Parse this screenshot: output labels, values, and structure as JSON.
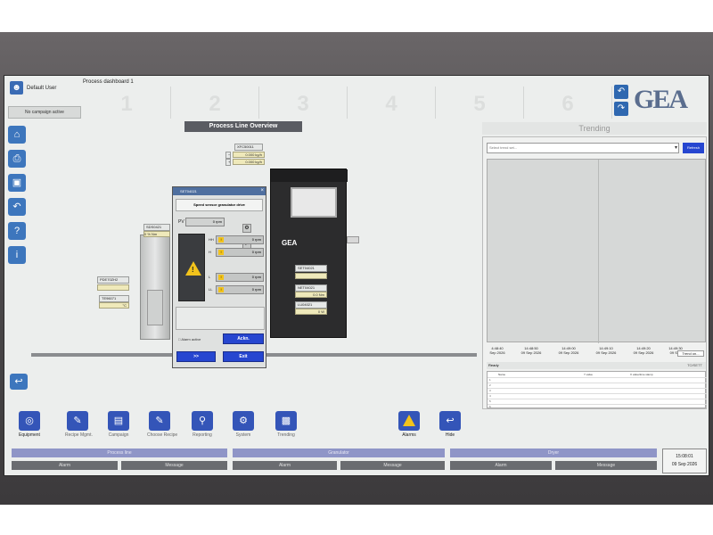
{
  "header": {
    "user": "Default User",
    "campaign": "No campaign active",
    "dashboard_title": "Process dashboard 1",
    "steps": [
      "1",
      "2",
      "3",
      "4",
      "5",
      "6"
    ],
    "logo": "GEA"
  },
  "overview": {
    "title": "Process Line Overview",
    "flow_tag": "XFC50011",
    "flow_value_1": "0.000 kg/h",
    "flow_value_2": "0.000 kg/h",
    "dryer_logo": "GEA",
    "dryer_tag_1": "SET04021",
    "dryer_tag_2": "NET04021",
    "dryer_value_2": "0.0 Nm",
    "dryer_tag_3": "LU04021",
    "dryer_value_3": "0 W",
    "left_tag_1": "PDE70ZH2",
    "left_tag_2": "TE96071",
    "left_value_2": "°C",
    "gran_tag": "SDS0421",
    "gran_value": "0 % Nm"
  },
  "popup": {
    "bar_title": "SET04021",
    "close": "×",
    "heading": "Speed sensor granulator drive",
    "pv_label": "PV",
    "pv_value": "0 rpm",
    "hh_label": "HH",
    "hh_value": "0 rpm",
    "h_label": "H",
    "h_value": "0 rpm",
    "l_label": "L",
    "l_value": "0 rpm",
    "ll_label": "LL",
    "ll_value": "0 rpm",
    "alarm_active": "Alarm active",
    "ackn": "Ackn.",
    "more": ">>",
    "exit": "Exit"
  },
  "trending": {
    "title": "Trending",
    "select_placeholder": "Select trend set...",
    "refresh": "Refresh",
    "times": [
      {
        "time": "4:48:40",
        "date": "Sep 2026"
      },
      {
        "time": "14:48:50",
        "date": "09 Sep 2026"
      },
      {
        "time": "14:49:00",
        "date": "09 Sep 2026"
      },
      {
        "time": "14:49:10",
        "date": "09 Sep 2026"
      },
      {
        "time": "14:49:20",
        "date": "09 Sep 2026"
      },
      {
        "time": "14:49:30",
        "date": "09 Sep"
      }
    ],
    "trend_on_label": "Trend on...",
    "status": "Ready",
    "status_right": "TO/SETT",
    "columns": [
      "Name",
      "Y value",
      "X value/time stamp"
    ],
    "rows": [
      "1",
      "2",
      "3",
      "4",
      "5",
      "6"
    ]
  },
  "toolbar": {
    "equipment": "Equipment",
    "recipe_mgmt": "Recipe Mgmt.",
    "campaign": "Campaign",
    "choose_recipe": "Choose Recipe",
    "reporting": "Reporting",
    "system": "System",
    "trending": "Trending",
    "alarms": "Alarms",
    "hide": "Hide"
  },
  "status_bar": {
    "groups": [
      {
        "title": "Process line",
        "alarm": "Alarm",
        "message": "Message"
      },
      {
        "title": "Granulator",
        "alarm": "Alarm",
        "message": "Message"
      },
      {
        "title": "Dryer",
        "alarm": "Alarm",
        "message": "Message"
      }
    ],
    "time": "15:08:01",
    "date": "09 Sep 2026"
  },
  "colors": {
    "accent_blue": "#2646d0",
    "icon_blue": "#3455b8",
    "warning_yellow": "#f2c31b"
  }
}
